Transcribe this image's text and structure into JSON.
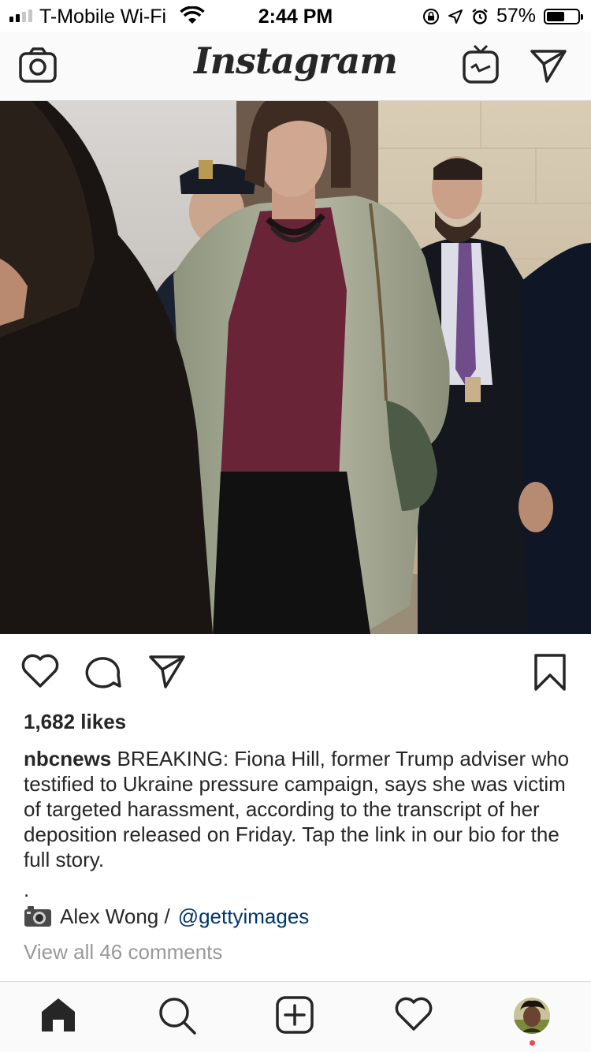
{
  "status_bar": {
    "carrier": "T-Mobile Wi-Fi",
    "time": "2:44 PM",
    "battery_percent": "57%",
    "battery_level": 0.57
  },
  "top_nav": {
    "logo": "Instagram",
    "icons": [
      "camera-icon",
      "igtv-icon",
      "direct-message-icon"
    ]
  },
  "post": {
    "image_description_icon": "photo",
    "actions": [
      "like-icon",
      "comment-icon",
      "share-icon",
      "bookmark-icon"
    ],
    "likes": "1,682 likes",
    "username": "nbcnews",
    "caption": "BREAKING: Fiona Hill, former Trump adviser who testified to Ukraine pressure campaign, says she was victim of targeted harassment, according to the transcript of her deposition released on Friday. Tap the link in our bio for the full story.",
    "dot": ".",
    "credit_prefix": "Alex Wong /",
    "credit_handle": "@gettyimages",
    "view_comments": "View all 46 comments"
  },
  "bottom_nav": {
    "tabs": [
      "home-icon",
      "search-icon",
      "new-post-icon",
      "activity-icon",
      "profile-avatar"
    ],
    "notification_color": "#ed4956"
  }
}
